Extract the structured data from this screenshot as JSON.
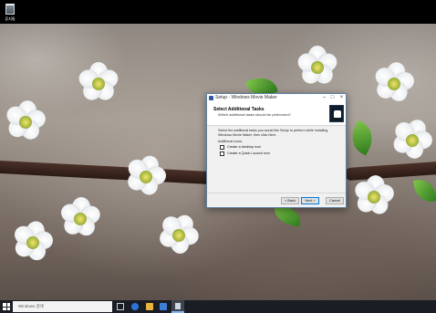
{
  "desktop": {
    "icons": [
      {
        "label": "휴지통"
      }
    ]
  },
  "dialog": {
    "title": "Setup - Windows Movie Maker",
    "window_buttons": {
      "minimize": "–",
      "maximize": "□",
      "close": "×"
    },
    "heading": "Select Additional Tasks",
    "subheading": "Which additional tasks should be performed?",
    "description": "Select the additional tasks you would like Setup to perform while installing Windows Movie Maker, then click Next.",
    "section_label": "Additional icons:",
    "checkboxes": [
      {
        "label": "Create a desktop icon",
        "checked": false
      },
      {
        "label": "Create a Quick Launch icon",
        "checked": false
      }
    ],
    "buttons": {
      "back": "< Back",
      "next": "Next >",
      "cancel": "Cancel"
    }
  },
  "taskbar": {
    "search_placeholder": "Windows 검색",
    "apps": [
      "task-view",
      "edge",
      "file-explorer",
      "store",
      "setup"
    ],
    "colors": {
      "accent": "#0078d7",
      "taskbar_bg": "#1a1d24"
    }
  }
}
